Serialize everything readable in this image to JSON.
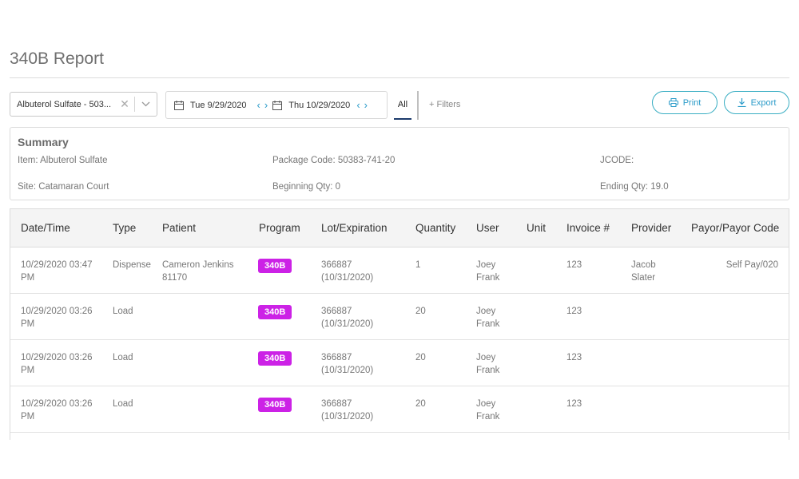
{
  "page": {
    "title": "340B Report"
  },
  "toolbar": {
    "item_select_value": "Albuterol Sulfate - 503...",
    "clear_glyph": "✕",
    "start_date": "Tue 9/29/2020",
    "end_date": "Thu 10/29/2020",
    "prev_glyph": "‹",
    "next_glyph": "›",
    "tab_all": "All",
    "filters": "+ Filters",
    "print_label": "Print",
    "export_label": "Export",
    "icons": [
      "close-icon",
      "chevron-down-icon",
      "calendar-icon",
      "chevron-left-icon",
      "chevron-right-icon",
      "printer-icon",
      "download-icon"
    ],
    "accent_color": "#2a9bc9"
  },
  "summary": {
    "title": "Summary",
    "item": "Item: Albuterol Sulfate",
    "package_code": "Package Code: 50383-741-20",
    "jcode": "JCODE:",
    "site": "Site: Catamaran Court",
    "beginning_qty": "Beginning Qty: 0",
    "ending_qty": "Ending Qty: 19.0"
  },
  "table": {
    "columns": [
      "Date/Time",
      "Type",
      "Patient",
      "Program",
      "Lot/Expiration",
      "Quantity",
      "User",
      "Unit",
      "Invoice #",
      "Provider",
      "Payor/Payor Code"
    ],
    "badge_color": "#cc22e6",
    "rows": [
      {
        "datetime_1": "10/29/2020 03:47",
        "datetime_2": "PM",
        "type": "Dispense",
        "patient_1": "Cameron Jenkins",
        "patient_2": "81170",
        "program": "340B",
        "lot_1": "366887",
        "lot_2": "(10/31/2020)",
        "quantity": "1",
        "user_1": "Joey",
        "user_2": "Frank",
        "unit": "",
        "invoice": "123",
        "provider_1": "Jacob",
        "provider_2": "Slater",
        "payor": "Self Pay/020"
      },
      {
        "datetime_1": "10/29/2020 03:26",
        "datetime_2": "PM",
        "type": "Load",
        "patient_1": "",
        "patient_2": "",
        "program": "340B",
        "lot_1": "366887",
        "lot_2": "(10/31/2020)",
        "quantity": "20",
        "user_1": "Joey",
        "user_2": "Frank",
        "unit": "",
        "invoice": "123",
        "provider_1": "",
        "provider_2": "",
        "payor": ""
      },
      {
        "datetime_1": "10/29/2020 03:26",
        "datetime_2": "PM",
        "type": "Load",
        "patient_1": "",
        "patient_2": "",
        "program": "340B",
        "lot_1": "366887",
        "lot_2": "(10/31/2020)",
        "quantity": "20",
        "user_1": "Joey",
        "user_2": "Frank",
        "unit": "",
        "invoice": "123",
        "provider_1": "",
        "provider_2": "",
        "payor": ""
      },
      {
        "datetime_1": "10/29/2020 03:26",
        "datetime_2": "PM",
        "type": "Load",
        "patient_1": "",
        "patient_2": "",
        "program": "340B",
        "lot_1": "366887",
        "lot_2": "(10/31/2020)",
        "quantity": "20",
        "user_1": "Joey",
        "user_2": "Frank",
        "unit": "",
        "invoice": "123",
        "provider_1": "",
        "provider_2": "",
        "payor": ""
      }
    ]
  }
}
